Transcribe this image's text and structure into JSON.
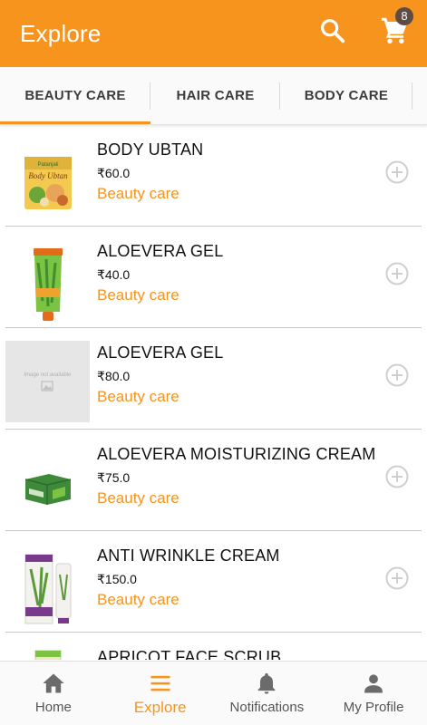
{
  "appbar": {
    "title": "Explore",
    "cart_count": "8"
  },
  "tabs": [
    {
      "label": "BEAUTY CARE",
      "active": true
    },
    {
      "label": "HAIR CARE",
      "active": false
    },
    {
      "label": "BODY CARE",
      "active": false
    }
  ],
  "products": [
    {
      "name": " BODY UBTAN",
      "price": "₹60.0",
      "category": "Beauty care",
      "image": "body-ubtan-packet"
    },
    {
      "name": "ALOEVERA GEL",
      "price": "₹40.0",
      "category": "Beauty care",
      "image": "aloevera-gel-tube"
    },
    {
      "name": "ALOEVERA GEL",
      "price": "₹80.0",
      "category": "Beauty care",
      "image": "image-not-available",
      "placeholder_text": "Image not available"
    },
    {
      "name": "ALOEVERA MOISTURIZING CREAM",
      "price": "₹75.0",
      "category": "Beauty care",
      "image": "moisturizing-cream-box"
    },
    {
      "name": "ANTI WRINKLE CREAM",
      "price": "₹150.0",
      "category": "Beauty care",
      "image": "anti-wrinkle-cream-box"
    },
    {
      "name": "APRICOT FACE SCRUB",
      "price": "",
      "category": "",
      "image": "apricot-scrub-tube"
    }
  ],
  "bottom_nav": [
    {
      "label": "Home",
      "icon": "home-icon",
      "active": false
    },
    {
      "label": "Explore",
      "icon": "menu-icon",
      "active": true
    },
    {
      "label": "Notifications",
      "icon": "bell-icon",
      "active": false
    },
    {
      "label": "My Profile",
      "icon": "person-icon",
      "active": false
    }
  ],
  "colors": {
    "accent": "#f7941d",
    "badge": "#5f4b46",
    "text": "#111111",
    "divider": "#c8c8c8"
  }
}
